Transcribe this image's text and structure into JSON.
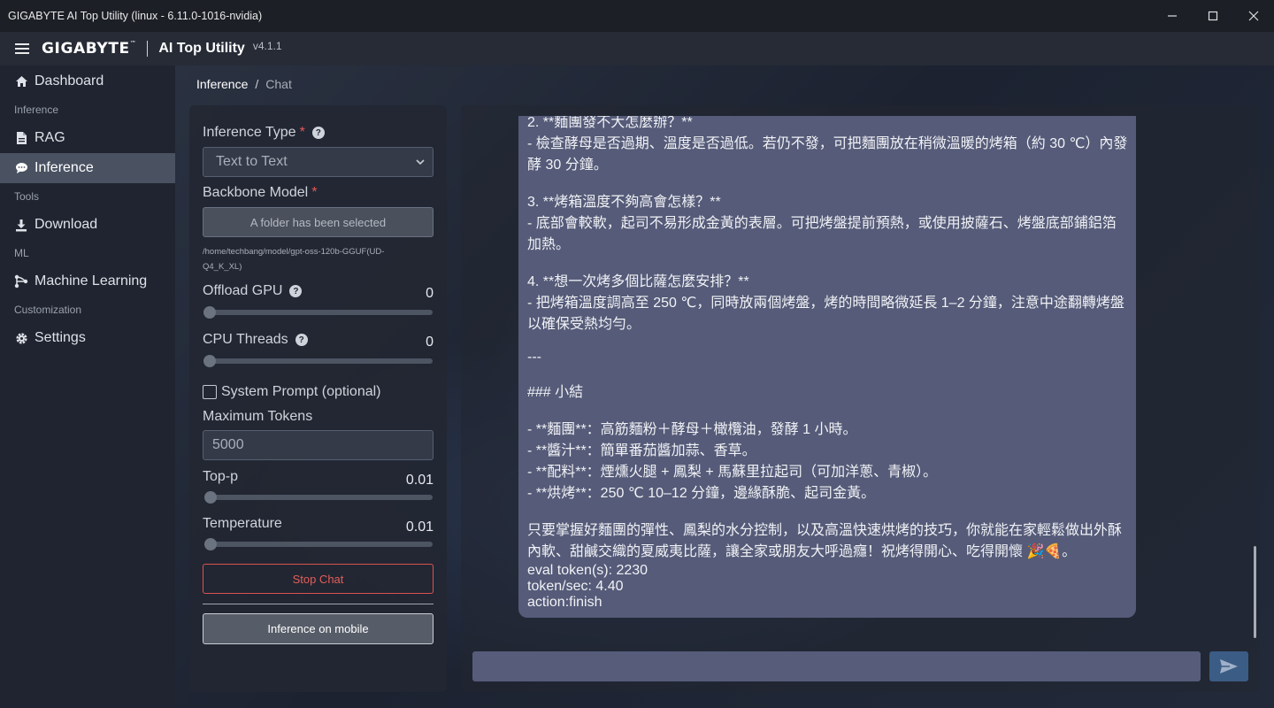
{
  "window": {
    "title": "GIGABYTE AI Top Utility (linux - 6.11.0-1016-nvidia)",
    "minimize": "─",
    "maximize": "☐",
    "close": "✕"
  },
  "header": {
    "brand": "GIGABYTE",
    "brand_tm": "™",
    "app_title": "AI Top Utility",
    "version": "v4.1.1"
  },
  "sidebar": {
    "dashboard": "Dashboard",
    "section_inference": "Inference",
    "rag": "RAG",
    "inference": "Inference",
    "section_tools": "Tools",
    "download": "Download",
    "section_ml": "ML",
    "machine_learning": "Machine Learning",
    "section_customization": "Customization",
    "settings": "Settings"
  },
  "breadcrumb": {
    "current": "Inference",
    "separator": "/",
    "leaf": "Chat"
  },
  "panel": {
    "inference_type_label": "Inference Type",
    "required_mark": "*",
    "help_mark": "?",
    "inference_type_value": "Text to Text",
    "backbone_label": "Backbone Model",
    "folder_button": "A folder has been selected",
    "model_path": "/home/techbang/model/gpt-oss-120b-GGUF(UD-Q4_K_XL)",
    "offload_gpu_label": "Offload GPU",
    "offload_gpu_value": "0",
    "offload_gpu_level": 0,
    "cpu_threads_label": "CPU Threads",
    "cpu_threads_value": "0",
    "cpu_threads_level": 0,
    "system_prompt_label": "System Prompt (optional)",
    "max_tokens_label": "Maximum Tokens",
    "max_tokens_value": "5000",
    "top_p_label": "Top-p",
    "top_p_value": "0.01",
    "temperature_label": "Temperature",
    "temperature_value": "0.01",
    "stop_chat": "Stop Chat",
    "inference_mobile": "Inference on mobile"
  },
  "chat": {
    "lines": [
      "2. **麵團發不大怎麼辦？**",
      "- 檢查酵母是否過期、溫度是否過低。若仍不發，可把麵團放在稍微溫暖的烤箱（約 30 ℃）內發",
      "酵 30 分鐘。",
      "3. **烤箱溫度不夠高會怎樣？**",
      "- 底部會較軟，起司不易形成金黃的表層。可把烤盤提前預熱，或使用披薩石、烤盤底部鋪鋁箔",
      "加熱。",
      "4. **想一次烤多個比薩怎麼安排？**",
      "- 把烤箱溫度調高至 250 ℃，同時放兩個烤盤，烤的時間略微延長 1–2 分鐘，注意中途翻轉烤盤",
      "以確保受熱均勻。",
      "---",
      "### 小結",
      "- **麵團**：高筋麵粉＋酵母＋橄欖油，發酵 1 小時。",
      "- **醬汁**：簡單番茄醬加蒜、香草。",
      "- **配料**：煙燻火腿 + 鳳梨 + 馬蘇里拉起司（可加洋蔥、青椒）。",
      "- **烘烤**：250 ℃ 10–12 分鐘，邊緣酥脆、起司金黃。",
      "只要掌握好麵團的彈性、鳳梨的水分控制，以及高溫快速烘烤的技巧，你就能在家輕鬆做出外酥",
      "內軟、甜鹹交織的夏威夷比薩，讓全家或朋友大呼過癮！祝烤得開心、吃得開懷 🎉🍕。",
      "eval token(s): 2230",
      "token/sec: 4.40",
      "action:finish"
    ],
    "input_value": ""
  }
}
